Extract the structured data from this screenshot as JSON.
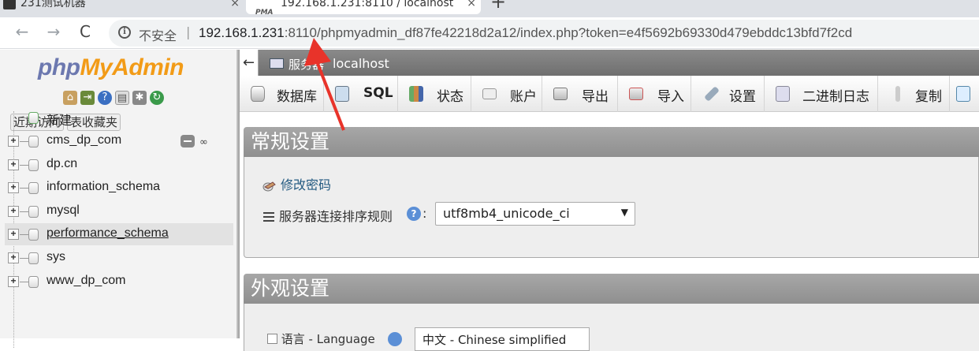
{
  "browser": {
    "tabs": [
      {
        "title": "231测试机器"
      },
      {
        "title": "192.168.1.231:8110 / localhost",
        "favicon_text": "PMA"
      }
    ],
    "new_tab": "+",
    "close": "×",
    "nav": {
      "back": "←",
      "forward": "→",
      "reload": "C"
    },
    "security_label": "不安全",
    "separator": "|",
    "url_host": "192.168.1.231",
    "url_rest": ":8110/phpmyadmin_df87fe42218d2a12/index.php?token=e4f5692b69330d479ebddc13bfd7f2cd"
  },
  "nav": {
    "logo_php": "php",
    "logo_myadmin": "MyAdmin",
    "tabs": [
      "近期访问",
      "表收藏夹"
    ],
    "databases": [
      {
        "name": "新建",
        "expandable": false
      },
      {
        "name": "cms_dp_com",
        "expandable": true
      },
      {
        "name": "dp.cn",
        "expandable": true
      },
      {
        "name": "information_schema",
        "expandable": true
      },
      {
        "name": "mysql",
        "expandable": true
      },
      {
        "name": "performance_schema",
        "expandable": true,
        "active": true
      },
      {
        "name": "sys",
        "expandable": true
      },
      {
        "name": "www_dp_com",
        "expandable": true
      }
    ]
  },
  "serverbar": {
    "collapse": "←",
    "label": "服务器",
    "host": "localhost"
  },
  "menu": [
    {
      "label": "数据库",
      "icon": "database-icon"
    },
    {
      "label": "SQL",
      "icon": "sql-icon"
    },
    {
      "label": "状态",
      "icon": "status-icon"
    },
    {
      "label": "账户",
      "icon": "accounts-icon"
    },
    {
      "label": "导出",
      "icon": "export-icon"
    },
    {
      "label": "导入",
      "icon": "import-icon"
    },
    {
      "label": "设置",
      "icon": "settings-icon"
    },
    {
      "label": "二进制日志",
      "icon": "binlog-icon"
    },
    {
      "label": "复制",
      "icon": "replication-icon"
    }
  ],
  "general": {
    "title": "常规设置",
    "change_password": "修改密码",
    "collation_label": "服务器连接排序规则",
    "colon": ":",
    "collation_value": "utf8mb4_unicode_ci",
    "caret": "▼"
  },
  "appearance": {
    "title": "外观设置",
    "language_label": "语言 - Language",
    "language_value": "中文 - Chinese simplified"
  },
  "colors": {
    "accent": "#f29b17",
    "php_blue": "#6c78af",
    "annotation": "#e8332a"
  }
}
